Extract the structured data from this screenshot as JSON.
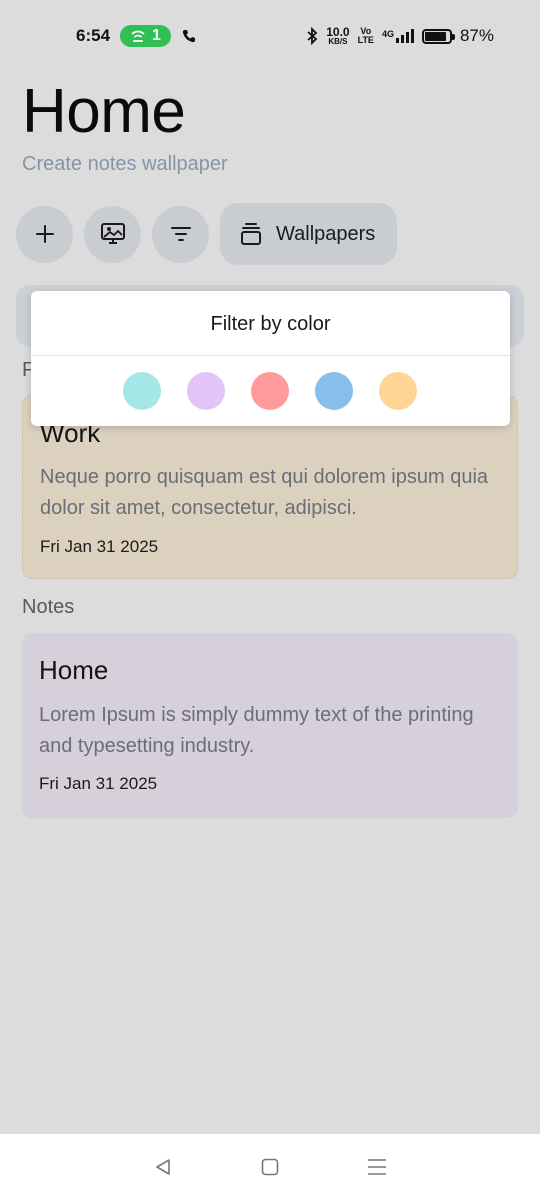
{
  "status_bar": {
    "time": "6:54",
    "hotspot_count": "1",
    "speed_value": "10.0",
    "speed_unit": "KB/S",
    "volte_top": "Vo",
    "volte_bottom": "LTE",
    "network": "4G",
    "battery": "87%",
    "battery_level": 0.87
  },
  "header": {
    "title": "Home",
    "subtitle": "Create notes wallpaper"
  },
  "toolbar": {
    "wallpapers_label": "Wallpapers",
    "icons": [
      "plus-icon",
      "wallpaper-icon",
      "filter-icon",
      "stack-icon"
    ]
  },
  "sections": {
    "pinned_partial": "P",
    "notes": "Notes"
  },
  "notes": [
    {
      "title": "Work",
      "body": "Neque porro quisquam est qui dolorem ipsum quia dolor sit amet, consectetur, adipisci.",
      "date": "Fri Jan 31 2025",
      "color": "#dcd1bf"
    },
    {
      "title": "Home",
      "body": "Lorem Ipsum is simply dummy text of the printing and typesetting industry.",
      "date": "Fri Jan 31 2025",
      "color": "#d6d0db"
    }
  ],
  "filter_popup": {
    "title": "Filter by color",
    "colors": [
      "#a5e6e6",
      "#e2c4f7",
      "#ff9b9b",
      "#86bfec",
      "#ffd494"
    ]
  },
  "colors": {
    "background": "#dcdcdc",
    "button": "#c9ccd1",
    "hotspot_green": "#2fbf55"
  }
}
